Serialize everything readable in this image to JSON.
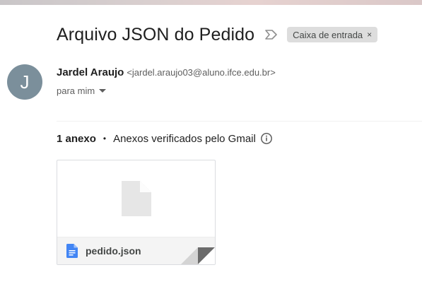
{
  "email": {
    "subject": "Arquivo JSON do Pedido",
    "label_chip": "Caixa de entrada",
    "label_close": "×",
    "importance_icon": "importance-marker-icon"
  },
  "sender": {
    "avatar_letter": "J",
    "avatar_color": "#7b8f9b",
    "name": "Jardel Araujo",
    "email_display": "<jardel.araujo03@aluno.ifce.edu.br>",
    "to_text": "para mim"
  },
  "attachments": {
    "count_text": "1 anexo",
    "separator": "•",
    "scan_text": "Anexos verificados pelo Gmail",
    "files": [
      {
        "name": "pedido.json",
        "icon": "google-docs-icon",
        "icon_color": "#4285f4"
      }
    ]
  }
}
